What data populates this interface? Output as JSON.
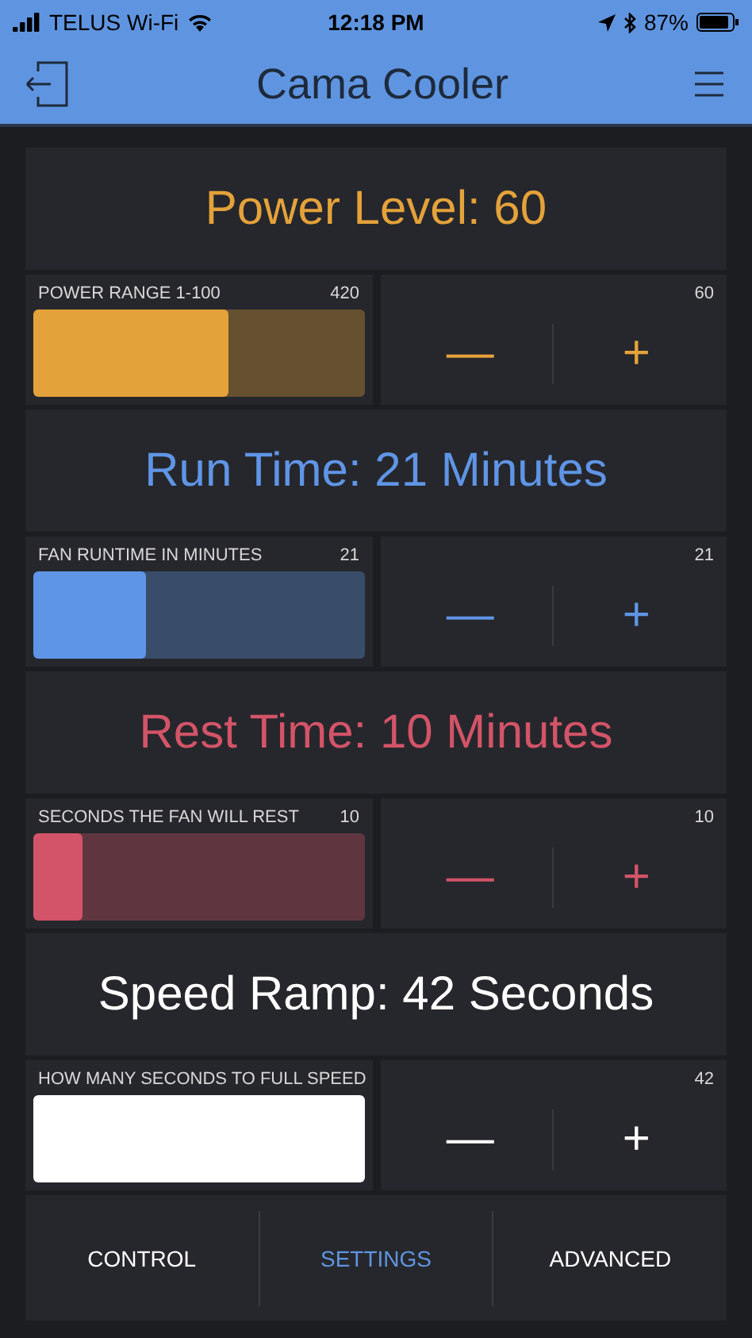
{
  "status_bar": {
    "carrier": "TELUS Wi-Fi",
    "time": "12:18 PM",
    "battery": "87%"
  },
  "nav": {
    "title": "Cama Cooler"
  },
  "sections": [
    {
      "title": "Power Level: 60",
      "color": "#e4a23a",
      "slider_label": "POWER RANGE 1-100",
      "slider_value": "420",
      "level": 0.59,
      "step_value": "60",
      "minus": "—",
      "plus": "+"
    },
    {
      "title": "Run Time: 21 Minutes",
      "color": "#5f95e6",
      "slider_label": "FAN RUNTIME IN MINUTES",
      "slider_value": "21",
      "level": 0.34,
      "step_value": "21",
      "minus": "—",
      "plus": "+"
    },
    {
      "title": "Rest Time: 10 Minutes",
      "color": "#d35468",
      "slider_label": "SECONDS THE FAN WILL REST",
      "slider_value": "10",
      "level": 0.15,
      "step_value": "10",
      "minus": "—",
      "plus": "+"
    },
    {
      "title": "Speed Ramp: 42 Seconds",
      "color": "#ffffff",
      "slider_label": "HOW MANY SECONDS TO FULL SPEED",
      "level": 1,
      "step_value": "42",
      "minus": "—",
      "plus": "+"
    }
  ],
  "tabs": [
    {
      "label": "CONTROL",
      "selected": false
    },
    {
      "label": "SETTINGS",
      "selected": true
    },
    {
      "label": "ADVANCED",
      "selected": false
    }
  ]
}
